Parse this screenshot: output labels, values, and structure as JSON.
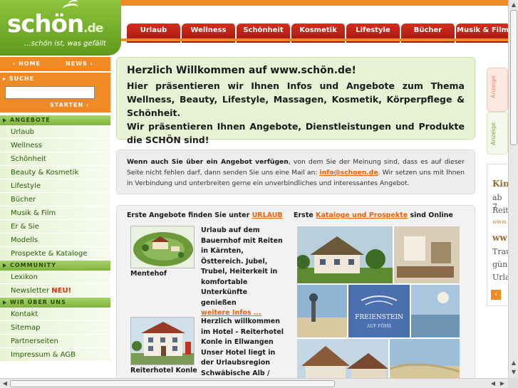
{
  "logo": {
    "word": "schön",
    "tld": ".de",
    "tagline": "...schön ist, was gefällt"
  },
  "nav": {
    "tabs": [
      "Urlaub",
      "Wellness",
      "Schönheit",
      "Kosmetik",
      "Lifestyle",
      "Bücher",
      "Musik & Film"
    ]
  },
  "quicklinks": {
    "home": "HOME",
    "news": "NEWS"
  },
  "search": {
    "title": "SUCHE",
    "value": "",
    "button": "STARTEN"
  },
  "menu": {
    "angebote": {
      "title": "ANGEBOTE",
      "items": [
        "Urlaub",
        "Wellness",
        "Schönheit",
        "Beauty & Kosmetik",
        "Lifestyle",
        "Bücher",
        "Musik & Film",
        "Er & Sie",
        "Modells",
        "Prospekte & Kataloge"
      ]
    },
    "community": {
      "title": "COMMUNITY",
      "items": [
        "Lexikon"
      ],
      "newsletter": "Newsletter",
      "neu": "NEU!"
    },
    "about": {
      "title": "WIR ÜBER UNS",
      "items": [
        "Kontakt",
        "Sitemap",
        "Partnerseiten",
        "Impressum & AGB"
      ]
    }
  },
  "welcome": {
    "title": "Herzlich Willkommen auf www.schön.de!",
    "line1": "Hier präsentieren wir Ihnen Infos und Angebote zum Thema Wellness, Beauty, Lifestyle, Massagen, Kosmetik, Körperpflege & Schönheit.",
    "line2": "Wir präsentieren Ihnen Angebote, Dienstleistungen und Produkte die SCHÖN sind!"
  },
  "offer": {
    "bold": "Wenn auch Sie über ein Angebot verfügen",
    "text1": ", von dem Sie der Meinung sind, dass es auf dieser Seite nicht fehlen darf, dann senden Sie uns eine Mail an: ",
    "email": "info@schoen.de",
    "text2": ". Wir setzen uns mit Ihnen in Verbindung und unterbreiten gerne ein unverbindliches und interessantes Angebot."
  },
  "listing": {
    "left_header": "Erste Angebote finden Sie unter ",
    "left_link": "URLAUB",
    "right_pre": "Erste ",
    "right_link": "Kataloge und Prospekte",
    "right_post": " sind Online",
    "items": [
      {
        "caption": "Mentehof",
        "desc": "Urlaub auf dem Bauernhof mit Reiten in Kärnten, Östtereich. Jubel, Trubel, Heiterkeit in komfortable Unterkünfte genießen",
        "more": "weitere Infos ..."
      },
      {
        "caption": "Reiterhotel Konle",
        "desc": "Herzlich willkommen im Hotel - Reiterhotel Konle in Ellwangen Unser Hotel liegt in der Urlaubsregion Schwäbische Alb /"
      }
    ],
    "catalog_title": "FREIENSTEIN",
    "catalog_sub": "AUF FÖHR"
  },
  "ads": {
    "label": "Anzeige",
    "right_lines": [
      "Kin",
      "ab 7",
      "Reit",
      "www.",
      "ww",
      "Trau",
      "gün",
      "Urla"
    ]
  },
  "colors": {
    "orange": "#f08a24",
    "green": "#7fb33a",
    "red": "#c22414",
    "link": "#e8630c"
  }
}
